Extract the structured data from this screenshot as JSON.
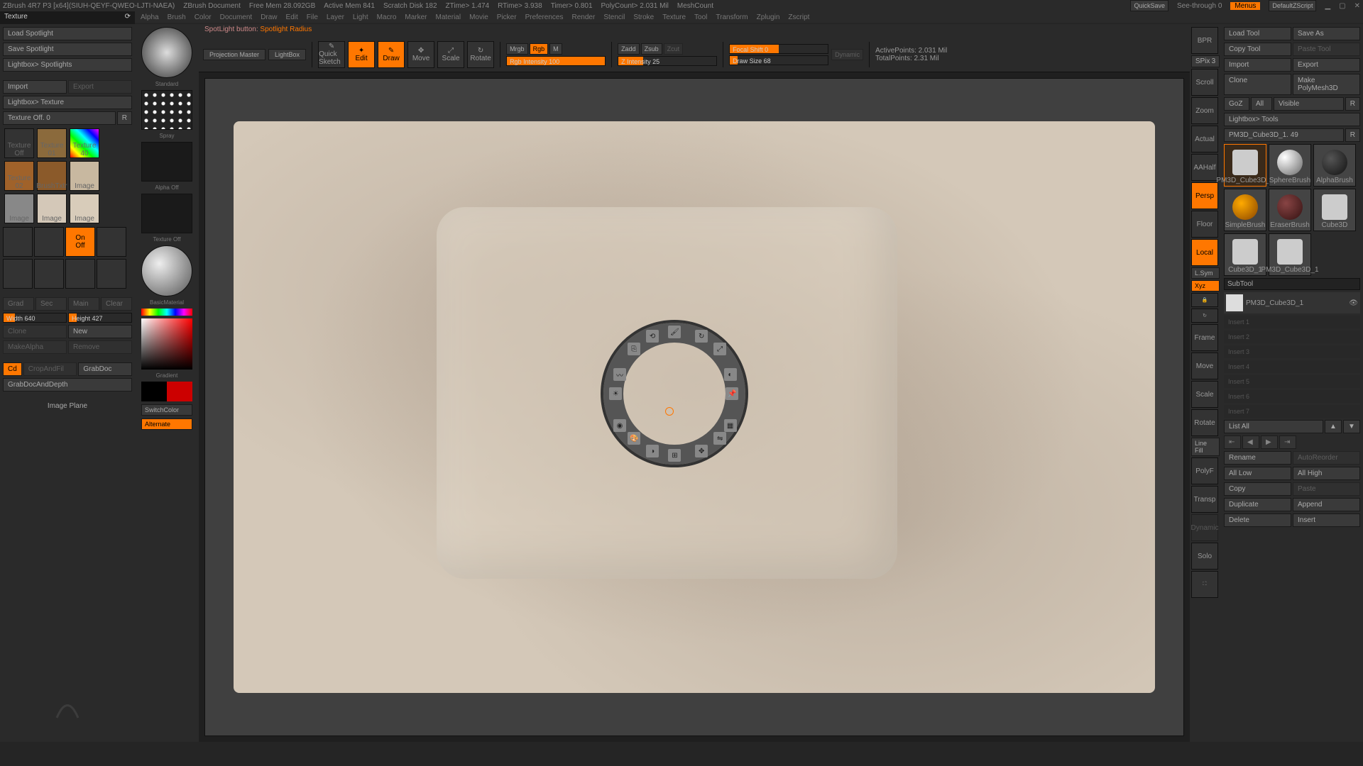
{
  "titlebar": {
    "app": "ZBrush 4R7 P3 [x64](SIUH-QEYF-QWEO-LJTI-NAEA)",
    "doc": "ZBrush Document",
    "freemem": "Free Mem 28.092GB",
    "activemem": "Active Mem 841",
    "scratch": "Scratch Disk 182",
    "ztime": "ZTime> 1.474",
    "rtime": "RTime> 3.938",
    "timer": "Timer> 0.801",
    "polycount": "PolyCount> 2.031 Mil",
    "meshcount": "MeshCount",
    "quicksave": "QuickSave",
    "seethrough": "See-through  0",
    "menus": "Menus",
    "default": "DefaultZScript"
  },
  "panel_title": "Texture",
  "menu": [
    "Alpha",
    "Brush",
    "Color",
    "Document",
    "Draw",
    "Edit",
    "File",
    "Layer",
    "Light",
    "Macro",
    "Marker",
    "Material",
    "Movie",
    "Picker",
    "Preferences",
    "Render",
    "Stencil",
    "Stroke",
    "Texture",
    "Tool",
    "Transform",
    "Zplugin",
    "Zscript"
  ],
  "status": {
    "label": "SpotLight button:",
    "value": "Spotlight Radius"
  },
  "left": {
    "load_spotlight": "Load Spotlight",
    "save_spotlight": "Save Spotlight",
    "lightbox_spotlights": "Lightbox> Spotlights",
    "import": "Import",
    "export": "Export",
    "lightbox_texture": "Lightbox> Texture",
    "texture_off": "Texture Off. 0",
    "r": "R",
    "thumbs": [
      "Texture Off",
      "Texture 01",
      "Texture 40",
      "Texture 02",
      "BrushTxtr",
      "Image",
      "Image",
      "Image",
      "Image"
    ],
    "on": "On",
    "off": "Off",
    "width": "Width 640",
    "height": "Height 427",
    "clone": "Clone",
    "new": "New",
    "makealpha": "MakeAlpha",
    "remove": "Remove",
    "cd": "Cd",
    "cropfill": "CropAndFil",
    "grabdoc": "GrabDoc",
    "grabdocdepth": "GrabDocAndDepth",
    "image_plane": "Image Plane"
  },
  "toolcol": {
    "brush": "Standard",
    "stroke": "Spray",
    "alpha": "Alpha Off",
    "texture": "Texture Off",
    "material": "BasicMaterial",
    "gradient": "Gradient",
    "switchcolor": "SwitchColor",
    "alternate": "Alternate"
  },
  "top": {
    "projection": "Projection Master",
    "lightbox": "LightBox",
    "quicksketch": "Quick Sketch",
    "edit": "Edit",
    "draw": "Draw",
    "move": "Move",
    "scale": "Scale",
    "rotate": "Rotate",
    "mrgb": "Mrgb",
    "rgb": "Rgb",
    "m": "M",
    "rgbint": "Rgb Intensity 100",
    "zadd": "Zadd",
    "zsub": "Zsub",
    "zcut": "Zcut",
    "zint": "Z Intensity 25",
    "focal": "Focal Shift 0",
    "drawsize": "Draw Size 68",
    "dynamic": "Dynamic",
    "activepoints": "ActivePoints: 2.031 Mil",
    "totalpoints": "TotalPoints: 2.31 Mil"
  },
  "rnav": {
    "bpr": "BPR",
    "spix_lbl": "SPix",
    "spix_v": "3",
    "scroll": "Scroll",
    "zoom": "Zoom",
    "actual": "Actual",
    "aahalf": "AAHalf",
    "persp": "Persp",
    "floor": "Floor",
    "local": "Local",
    "lsym": "L.Sym",
    "xyz": "Xyz",
    "frame": "Frame",
    "move": "Move",
    "scale": "Scale",
    "rotate": "Rotate",
    "linefill": "Line Fill",
    "polyf": "PolyF",
    "transp": "Transp",
    "dynamic": "Dynamic",
    "solo": "Solo"
  },
  "right": {
    "loadtool": "Load Tool",
    "saveas": "Save As",
    "copytool": "Copy Tool",
    "pastetool": "Paste Tool",
    "import": "Import",
    "export": "Export",
    "clone": "Clone",
    "makepoly": "Make PolyMesh3D",
    "goz": "GoZ",
    "all": "All",
    "visible": "Visible",
    "r": "R",
    "lightbox_tools": "Lightbox> Tools",
    "current_tool": "PM3D_Cube3D_1. 49",
    "tools": [
      "PM3D_Cube3D_1",
      "SphereBrush",
      "AlphaBrush",
      "SimpleBrush",
      "EraserBrush",
      "Cube3D",
      "Cube3D_1",
      "PM3D_Cube3D_1"
    ],
    "subtool": "SubTool",
    "subtool_item": "PM3D_Cube3D_1",
    "insert_slots": [
      "Insert 1",
      "Insert 2",
      "Insert 3",
      "Insert 4",
      "Insert 5",
      "Insert 6",
      "Insert 7"
    ],
    "listall": "List All",
    "rename": "Rename",
    "autoreorder": "AutoReorder",
    "alllow": "All Low",
    "allhigh": "All High",
    "copy": "Copy",
    "paste": "Paste",
    "duplicate": "Duplicate",
    "append": "Append",
    "delete": "Delete",
    "insert": "Insert"
  },
  "chart_data": null
}
